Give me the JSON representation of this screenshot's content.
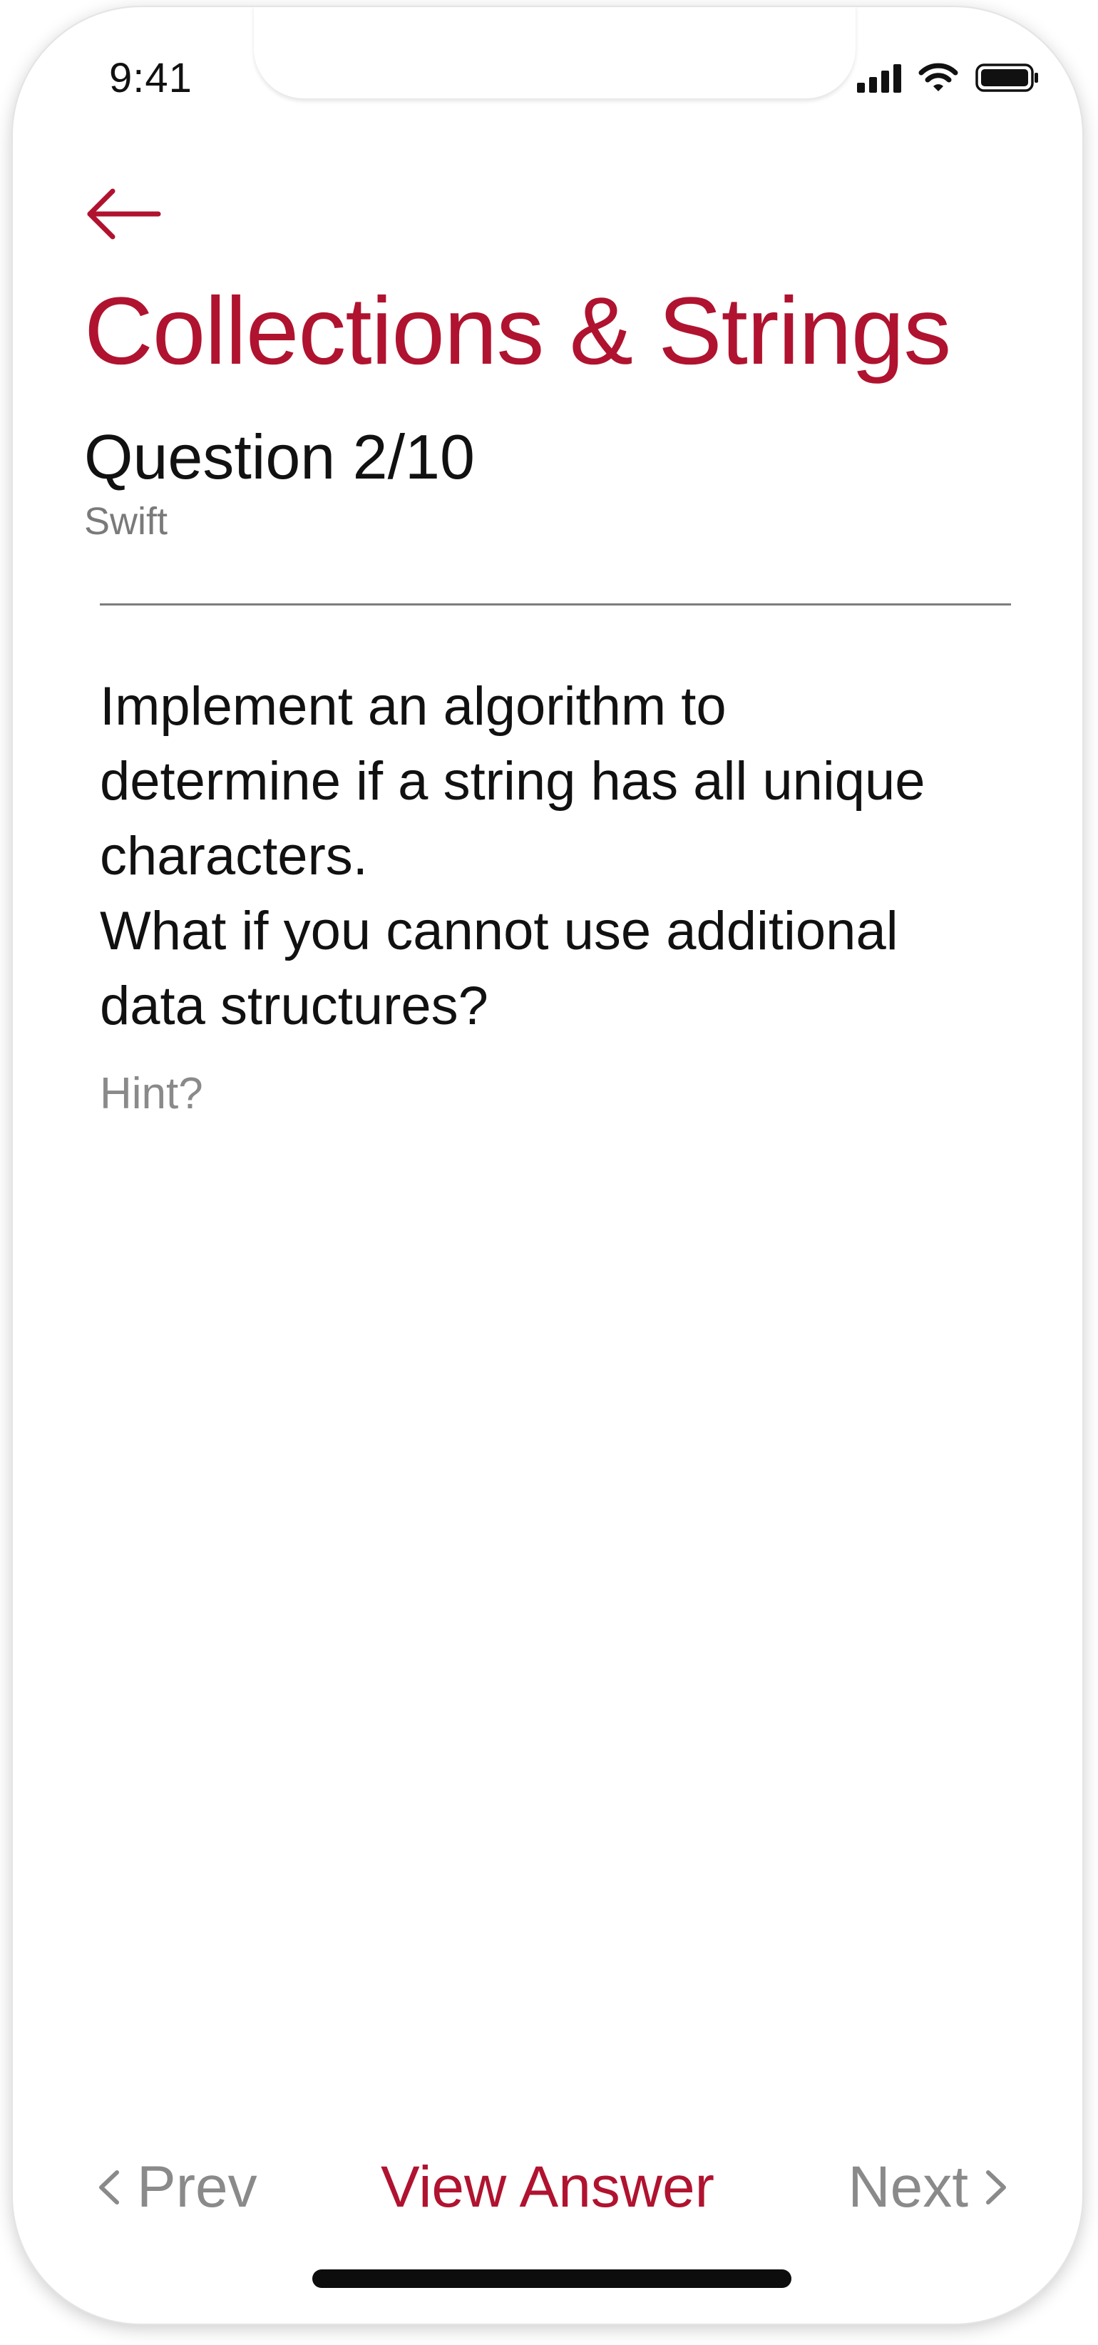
{
  "status_bar": {
    "time": "9:41",
    "signal_icon": "cellular-signal-icon",
    "wifi_icon": "wifi-icon",
    "battery_icon": "battery-icon"
  },
  "header": {
    "back_icon": "back-arrow-icon",
    "title": "Collections & Strings",
    "question_counter": "Question 2/10",
    "subject": "Swift"
  },
  "question": {
    "text": "Implement an algorithm to\ndetermine if a string has all unique\ncharacters.\nWhat if you cannot use additional\ndata structures?",
    "hint_label": "Hint?"
  },
  "bottom_nav": {
    "prev_label": "Prev",
    "view_answer_label": "View Answer",
    "next_label": "Next",
    "prev_icon": "chevron-left-icon",
    "next_icon": "chevron-right-icon"
  },
  "colors": {
    "accent": "#b0132f",
    "text_primary": "#111111",
    "text_muted": "#8a8a8a",
    "background": "#ffffff"
  }
}
